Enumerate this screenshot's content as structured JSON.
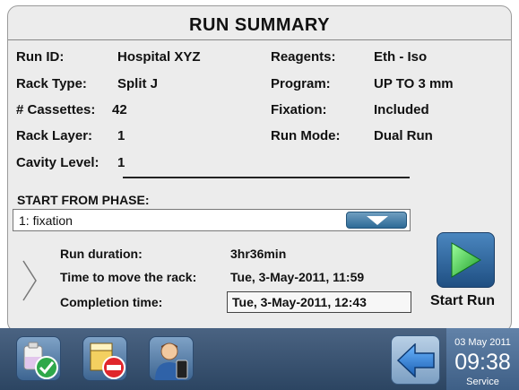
{
  "title": "RUN SUMMARY",
  "details": {
    "run_id_label": "Run ID:",
    "run_id_value": "Hospital XYZ",
    "rack_type_label": "Rack Type:",
    "rack_type_value": "Split J",
    "cassettes_label": "# Cassettes:",
    "cassettes_value": "42",
    "rack_layer_label": "Rack Layer:",
    "rack_layer_value": "1",
    "cavity_level_label": "Cavity Level:",
    "cavity_level_value": "1",
    "reagents_label": "Reagents:",
    "reagents_value": "Eth - Iso",
    "program_label": "Program:",
    "program_value": "UP TO 3 mm",
    "fixation_label": "Fixation:",
    "fixation_value": "Included",
    "run_mode_label": "Run Mode:",
    "run_mode_value": "Dual Run"
  },
  "start_phase": {
    "label": "START FROM PHASE:",
    "selected": "1: fixation"
  },
  "timing": {
    "run_duration_label": "Run duration:",
    "run_duration_value": "3hr36min",
    "move_rack_label": "Time to move the rack:",
    "move_rack_value": "Tue, 3-May-2011, 11:59",
    "completion_label": "Completion time:",
    "completion_value": "Tue, 3-May-2011, 12:43"
  },
  "start_run_label": "Start Run",
  "status_bar": {
    "date": "03 May 2011",
    "time": "09:38",
    "role": "Service"
  },
  "colors": {
    "panel_bg": "#ececec",
    "taskbar": "#3a5474",
    "accent_blue": "#2d6a96",
    "start_green": "#3cc43c"
  },
  "icons": [
    "reagent-ok-icon",
    "bath-blocked-icon",
    "user-icon",
    "back-arrow-icon",
    "play-icon",
    "dropdown-chevron-icon",
    "expand-chevron-icon"
  ]
}
